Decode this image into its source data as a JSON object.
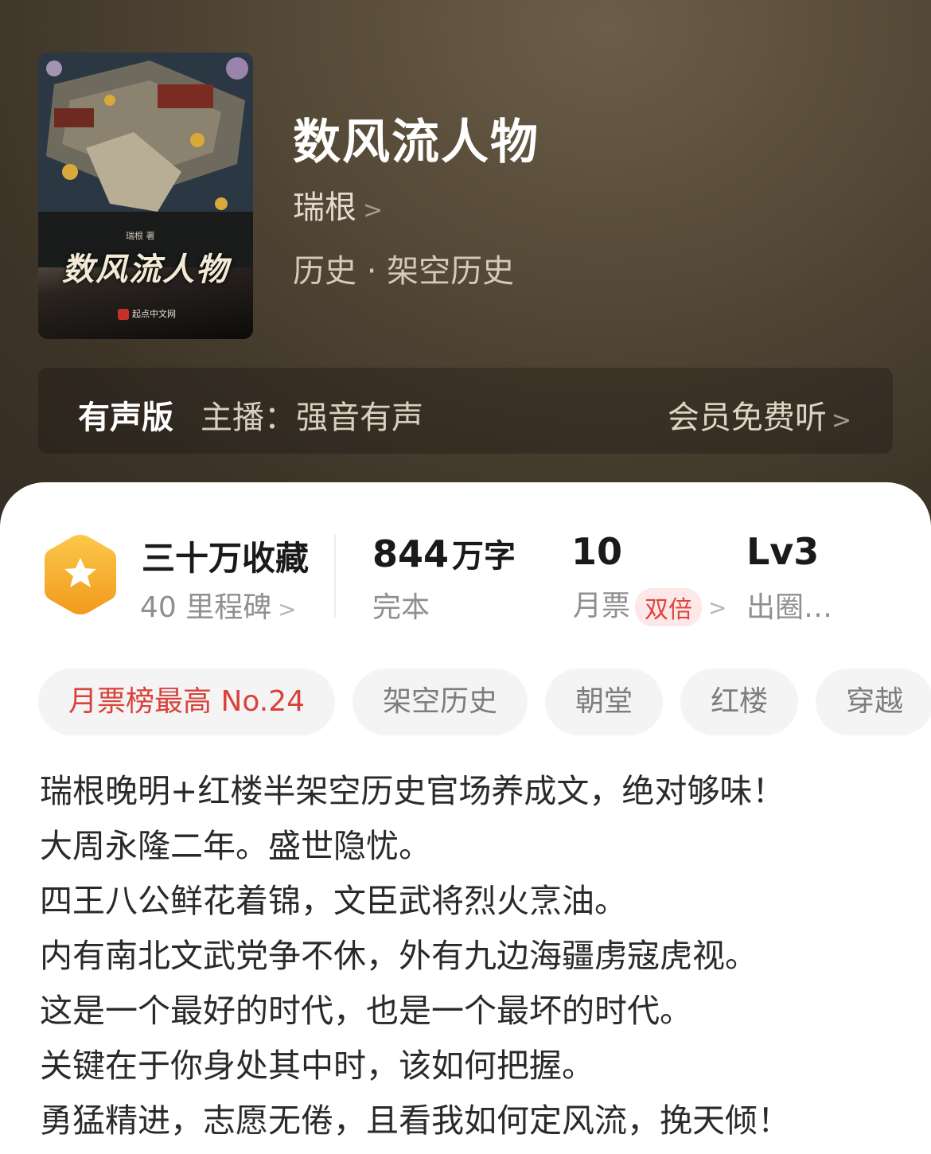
{
  "book": {
    "title": "数风流人物",
    "author": "瑞根",
    "category": "历史 · 架空历史",
    "cover": {
      "title": "数风流人物",
      "author_line": "瑞根 著",
      "publisher": "起点中文网"
    }
  },
  "audio": {
    "tag": "有声版",
    "host": "主播：强音有声",
    "action": "会员免费听"
  },
  "stats": {
    "favorites": {
      "value": "三十万收藏",
      "sub": "40 里程碑"
    },
    "words": {
      "value": "844",
      "unit": "万字",
      "sub": "完本"
    },
    "tickets": {
      "value": "10",
      "sub": "月票",
      "badge": "双倍"
    },
    "level": {
      "value": "Lv3",
      "sub": "出圈…"
    }
  },
  "tags": [
    "月票榜最高 No.24",
    "架空历史",
    "朝堂",
    "红楼",
    "穿越"
  ],
  "intro": [
    "瑞根晚明+红楼半架空历史官场养成文，绝对够味！",
    "大周永隆二年。盛世隐忧。",
    "四王八公鲜花着锦，文臣武将烈火烹油。",
    "内有南北文武党争不休，外有九边海疆虏寇虎视。",
    "这是一个最好的时代，也是一个最坏的时代。",
    "关键在于你身处其中时，该如何把握。",
    "勇猛精进，志愿无倦，且看我如何定风流，挽天倾！"
  ],
  "colors": {
    "header_bg": "#4a3f31",
    "accent_red": "#e0433d",
    "badge_orange": "#f4a623"
  },
  "icons": [
    "star-hexagon-icon",
    "chevron-right-icon"
  ]
}
